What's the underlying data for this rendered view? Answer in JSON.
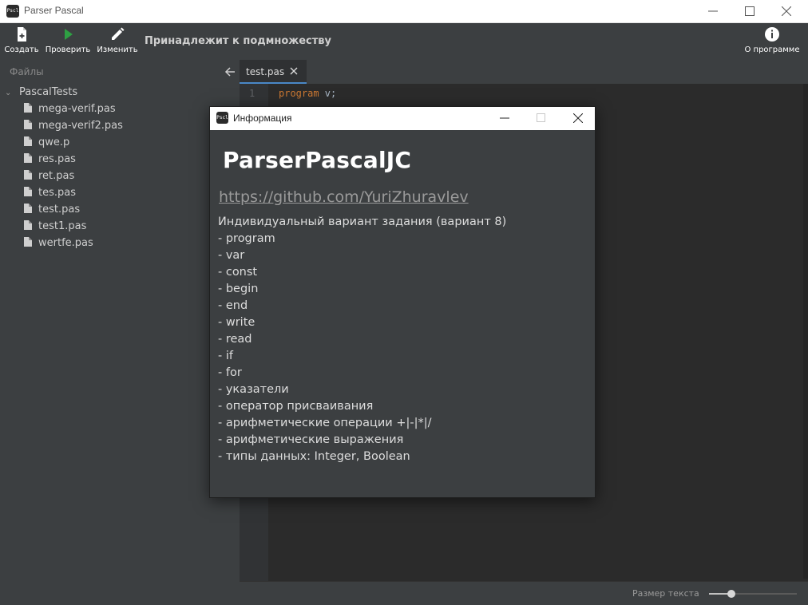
{
  "window": {
    "title": "Parser Pascal",
    "icon_text": "Pscl"
  },
  "toolbar": {
    "create_label": "Создать",
    "check_label": "Проверить",
    "edit_label": "Изменить",
    "about_label": "О программе",
    "status_message": "Принадлежит к подмножеству",
    "check_icon_color": "#2ea043"
  },
  "sidebar": {
    "header": "Файлы",
    "root_folder": "PascalTests",
    "files": [
      "mega-verif.pas",
      "mega-verif2.pas",
      "qwe.p",
      "res.pas",
      "ret.pas",
      "tes.pas",
      "test.pas",
      "test1.pas",
      "wertfe.pas"
    ]
  },
  "editor": {
    "tab_name": "test.pas",
    "line_number": "1",
    "code_keyword": "program",
    "code_rest": " v;"
  },
  "bottombar": {
    "font_size_label": "Размер текста",
    "font_size_level": 0.25
  },
  "dialog": {
    "title": "Информация",
    "app_name": "ParserPascalJC",
    "link": "https://github.com/YuriZhuravlev",
    "lines": [
      "Индивидуальный вариант задания (вариант 8)",
      "- program",
      "- var",
      "- const",
      "- begin",
      "- end",
      "- write",
      "- read",
      "- if",
      "- for",
      "- указатели",
      "- оператор присваивания",
      "- арифметические операции +|-|*|/",
      "- арифметические выражения",
      "- типы данных: Integer, Boolean"
    ]
  }
}
